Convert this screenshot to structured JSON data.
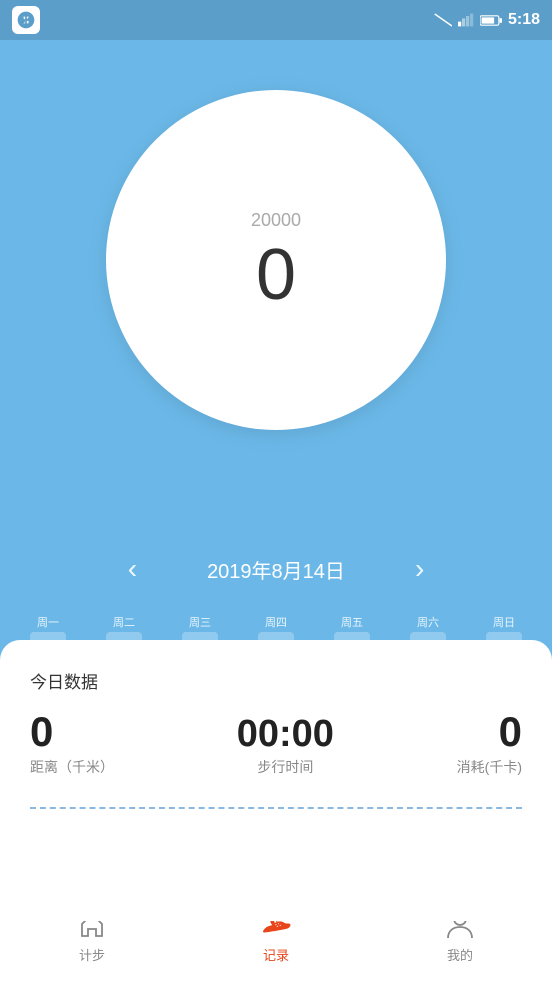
{
  "statusBar": {
    "time": "5:18",
    "icons": [
      "wifi",
      "signal",
      "battery"
    ]
  },
  "circle": {
    "goal": "20000",
    "steps": "0"
  },
  "dateNav": {
    "date": "2019年8月14日",
    "prevArrow": "‹",
    "nextArrow": "›"
  },
  "weekBar": {
    "days": [
      "周一",
      "周二",
      "周三",
      "周四",
      "周五",
      "周六",
      "周日"
    ]
  },
  "todayData": {
    "sectionTitle": "今日数据",
    "distance": {
      "value": "0",
      "label": "距离（千米）"
    },
    "walkTime": {
      "value": "00:00",
      "label": "步行时间"
    },
    "calories": {
      "value": "0",
      "label": "消耗(千卡)"
    }
  },
  "bottomNav": {
    "items": [
      {
        "id": "jibu",
        "label": "计步",
        "active": false
      },
      {
        "id": "jilu",
        "label": "记录",
        "active": true
      },
      {
        "id": "wode",
        "label": "我的",
        "active": false
      }
    ]
  }
}
